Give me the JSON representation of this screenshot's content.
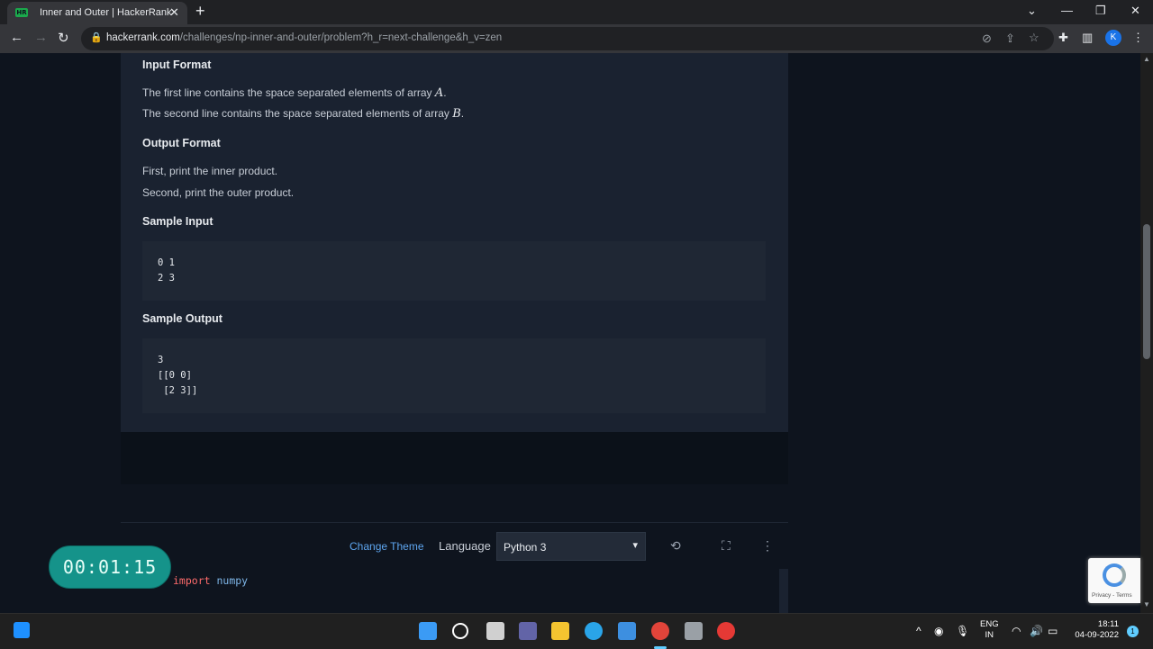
{
  "browser": {
    "tab_title": "Inner and Outer | HackerRank",
    "tab_favicon": "HR",
    "url_host": "hackerrank.com",
    "url_path": "/challenges/np-inner-and-outer/problem?h_r=next-challenge&h_v=zen",
    "profile_initial": "K"
  },
  "problem": {
    "input_format_heading": "Input Format",
    "input_line1_prefix": "The first line contains the space separated elements of array ",
    "input_line1_var": "A",
    "input_line1_suffix": ".",
    "input_line2_prefix": "The second line contains the space separated elements of array ",
    "input_line2_var": "B",
    "input_line2_suffix": ".",
    "output_format_heading": "Output Format",
    "output_line1": "First, print the inner product.",
    "output_line2": "Second, print the outer product.",
    "sample_input_heading": "Sample Input",
    "sample_input": "0 1\n2 3",
    "sample_output_heading": "Sample Output",
    "sample_output": "3\n[[0 0]\n [2 3]]"
  },
  "editor": {
    "change_theme": "Change Theme",
    "language_label": "Language",
    "language_value": "Python 3",
    "code_keyword": "import",
    "code_module": "numpy"
  },
  "timer": "00:01:15",
  "recaptcha": {
    "text": "Privacy - Terms"
  },
  "taskbar": {
    "lang_line1": "ENG",
    "lang_line2": "IN",
    "time": "18:11",
    "date": "04-09-2022",
    "notifications": "1"
  }
}
